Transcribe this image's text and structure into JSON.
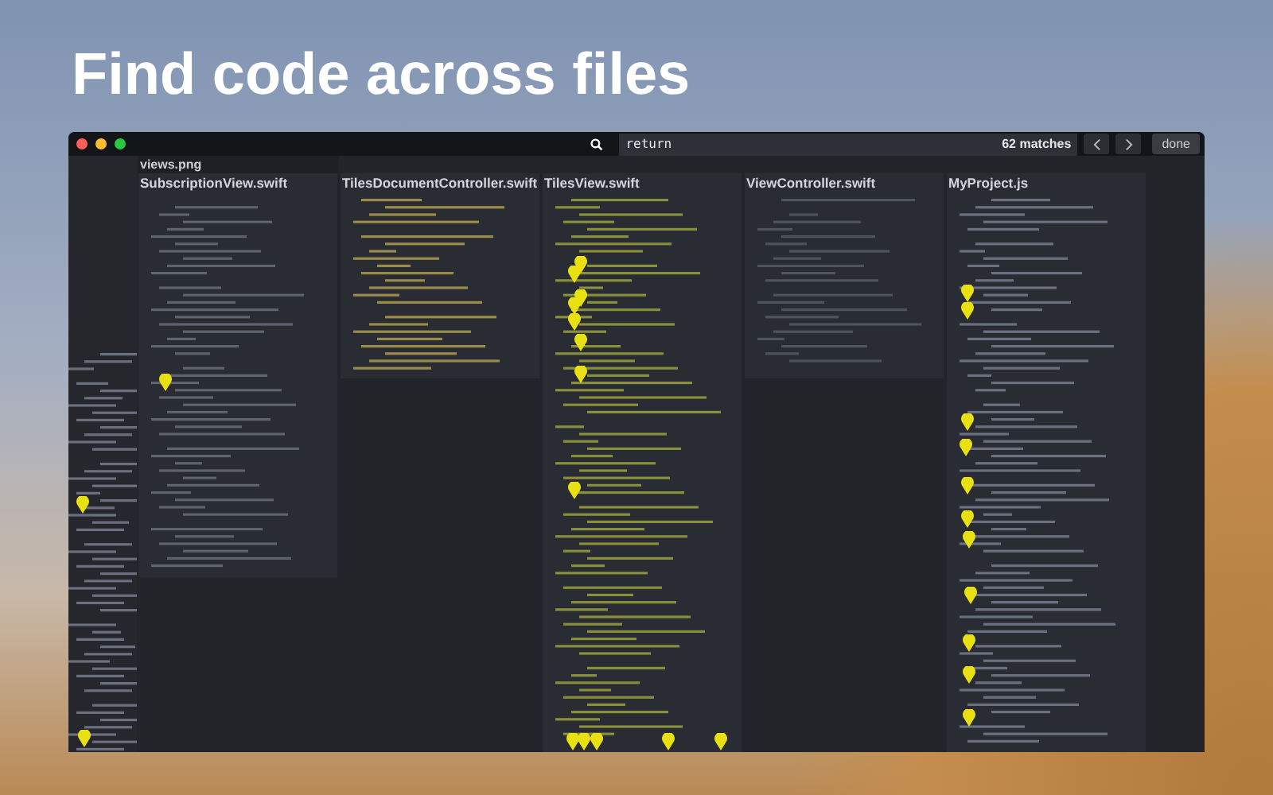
{
  "headline": "Find code across files",
  "toolbar": {
    "search": {
      "value": "return"
    },
    "match_count": "62 matches",
    "done_button": "done"
  },
  "canvas": {
    "image_label": "views.png",
    "files": [
      {
        "name": "SubscriptionView.swift"
      },
      {
        "name": "TilesDocumentController.swift"
      },
      {
        "name": "TilesView.swift"
      },
      {
        "name": "ViewController.swift"
      },
      {
        "name": "MyProject.js"
      }
    ]
  }
}
